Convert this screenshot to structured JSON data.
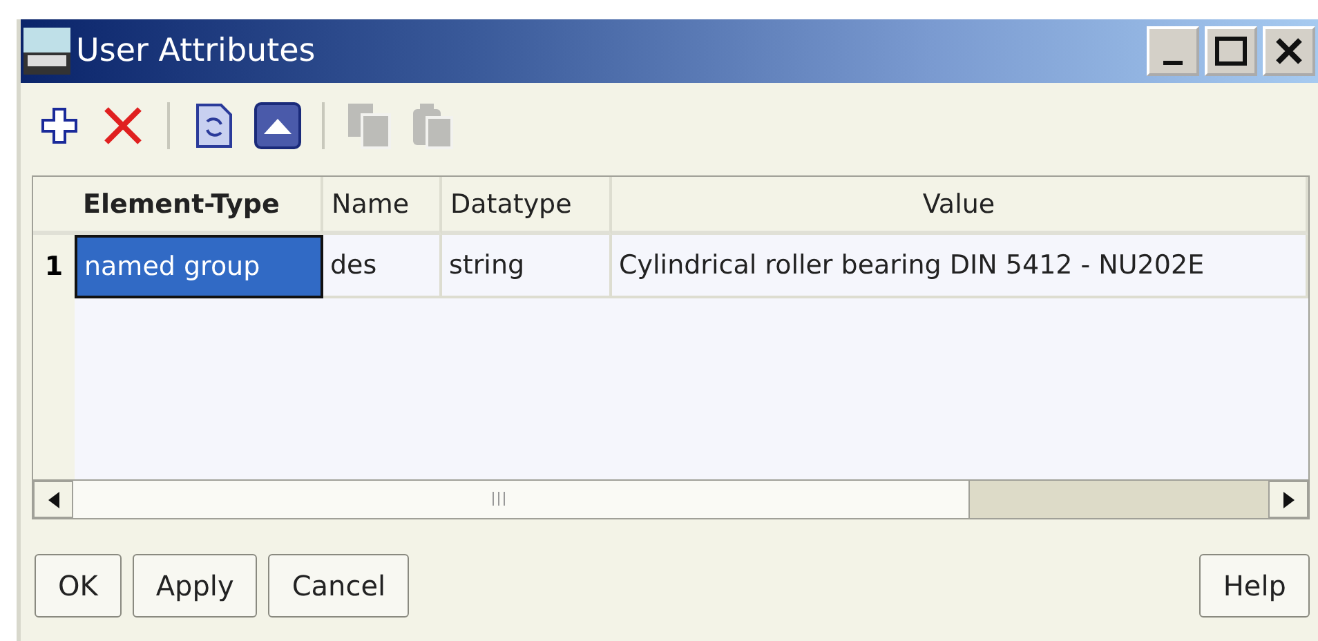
{
  "window": {
    "title": "User Attributes",
    "controls": [
      {
        "kind": "minimize"
      },
      {
        "kind": "maximize"
      },
      {
        "kind": "close"
      }
    ]
  },
  "toolbar": [
    {
      "kind": "add",
      "disabled": false
    },
    {
      "kind": "delete",
      "disabled": false
    },
    {
      "kind": "separator"
    },
    {
      "kind": "refresh",
      "disabled": false
    },
    {
      "kind": "up",
      "disabled": false
    },
    {
      "kind": "separator"
    },
    {
      "kind": "copy",
      "disabled": true
    },
    {
      "kind": "paste",
      "disabled": true
    }
  ],
  "table": {
    "columns": [
      {
        "label": "Element-Type",
        "bold": true
      },
      {
        "label": "Name",
        "bold": false
      },
      {
        "label": "Datatype",
        "bold": false
      },
      {
        "label": "Value",
        "bold": false
      }
    ],
    "rows": [
      {
        "number": "1",
        "cells": [
          {
            "text": "named group",
            "selected": true
          },
          {
            "text": "des",
            "selected": false
          },
          {
            "text": "string",
            "selected": false
          },
          {
            "text": "Cylindrical roller bearing DIN 5412 - NU202E",
            "selected": false
          }
        ]
      }
    ]
  },
  "buttons_left": [
    "OK",
    "Apply",
    "Cancel"
  ],
  "buttons_right": [
    "Help"
  ]
}
